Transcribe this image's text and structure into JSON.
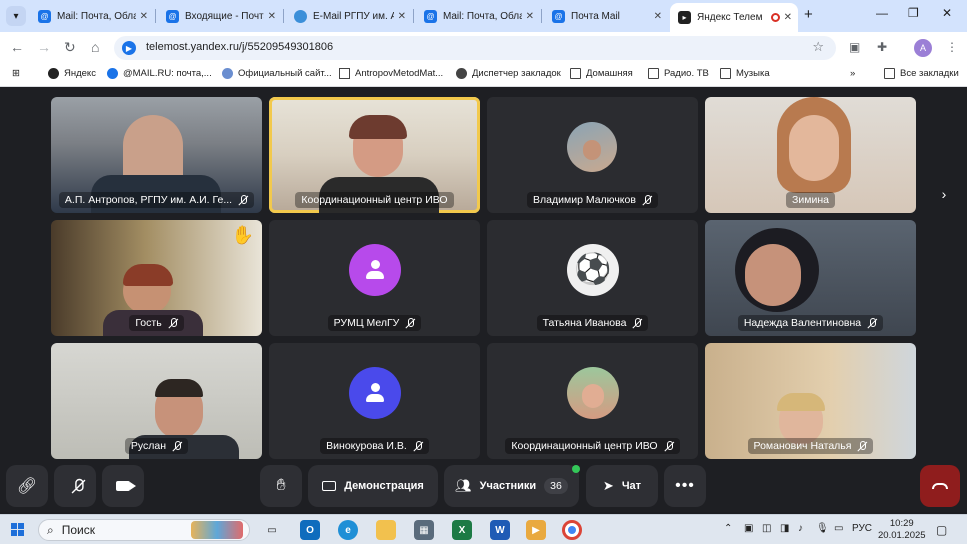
{
  "browser": {
    "tabs": [
      {
        "title": "Mail: Почта, Облак",
        "icon": "mail-at-icon"
      },
      {
        "title": "Входящие - Почта",
        "icon": "mail-at-icon"
      },
      {
        "title": "E-Mail РГПУ им. А.",
        "icon": "globe-icon"
      },
      {
        "title": "Mail: Почта, Облак",
        "icon": "mail-at-icon"
      },
      {
        "title": "Почта Mail",
        "icon": "mail-at-icon"
      },
      {
        "title": "Яндекс Телем",
        "icon": "telemost-icon",
        "active": true
      }
    ],
    "url": "telemost.yandex.ru/j/55209549301806",
    "profile_initial": "A",
    "bookmarks": [
      {
        "label": "Яндекс",
        "icon": "yandex-icon"
      },
      {
        "label": "@MAIL.RU: почта,...",
        "icon": "mail-at-icon"
      },
      {
        "label": "Официальный сайт...",
        "icon": "site-icon"
      },
      {
        "label": "AntropovMetodMat...",
        "icon": "doc-icon"
      },
      {
        "label": "Диспетчер закладок",
        "icon": "globe-icon"
      },
      {
        "label": "Домашняя",
        "icon": "folder-icon"
      },
      {
        "label": "Радио. ТВ",
        "icon": "folder-icon"
      },
      {
        "label": "Музыка",
        "icon": "folder-icon"
      }
    ],
    "all_bookmarks": "Все закладки"
  },
  "participants": [
    {
      "name": "А.П. Антропов, РГПУ им. А.И. Ге...",
      "kind": "video",
      "muted": true
    },
    {
      "name": "Координационный центр ИВО",
      "kind": "video",
      "muted": false,
      "speaking": true
    },
    {
      "name": "Владимир Малючков",
      "kind": "photo-avatar",
      "muted": true
    },
    {
      "name": "Зимина",
      "kind": "video",
      "muted": false
    },
    {
      "name": "Гость",
      "kind": "video",
      "muted": true,
      "hand_raised": true
    },
    {
      "name": "РУМЦ МелГУ",
      "kind": "avatar-purple",
      "muted": true
    },
    {
      "name": "Татьяна Иванова",
      "kind": "ball-avatar",
      "muted": true
    },
    {
      "name": "Надежда Валентиновна",
      "kind": "video",
      "muted": true
    },
    {
      "name": "Руслан",
      "kind": "video",
      "muted": true
    },
    {
      "name": "Винокурова И.В.",
      "kind": "avatar-blue",
      "muted": true
    },
    {
      "name": "Координационный центр ИВО",
      "kind": "photo-avatar",
      "muted": true
    },
    {
      "name": "Романович Наталья",
      "kind": "video",
      "muted": true
    }
  ],
  "controls": {
    "demo_label": "Демонстрация",
    "participants_label": "Участники",
    "participants_count": "36",
    "chat_label": "Чат"
  },
  "taskbar": {
    "search_placeholder": "Поиск",
    "lang": "РУС",
    "time": "10:29",
    "date": "20.01.2025"
  },
  "colors": {
    "stage_bg": "#1e1f23",
    "tile_bg": "#2b2c30",
    "speaking_outline": "#f2c94c",
    "hangup": "#8f1d1d",
    "tab_bar": "#d3e3fd"
  }
}
